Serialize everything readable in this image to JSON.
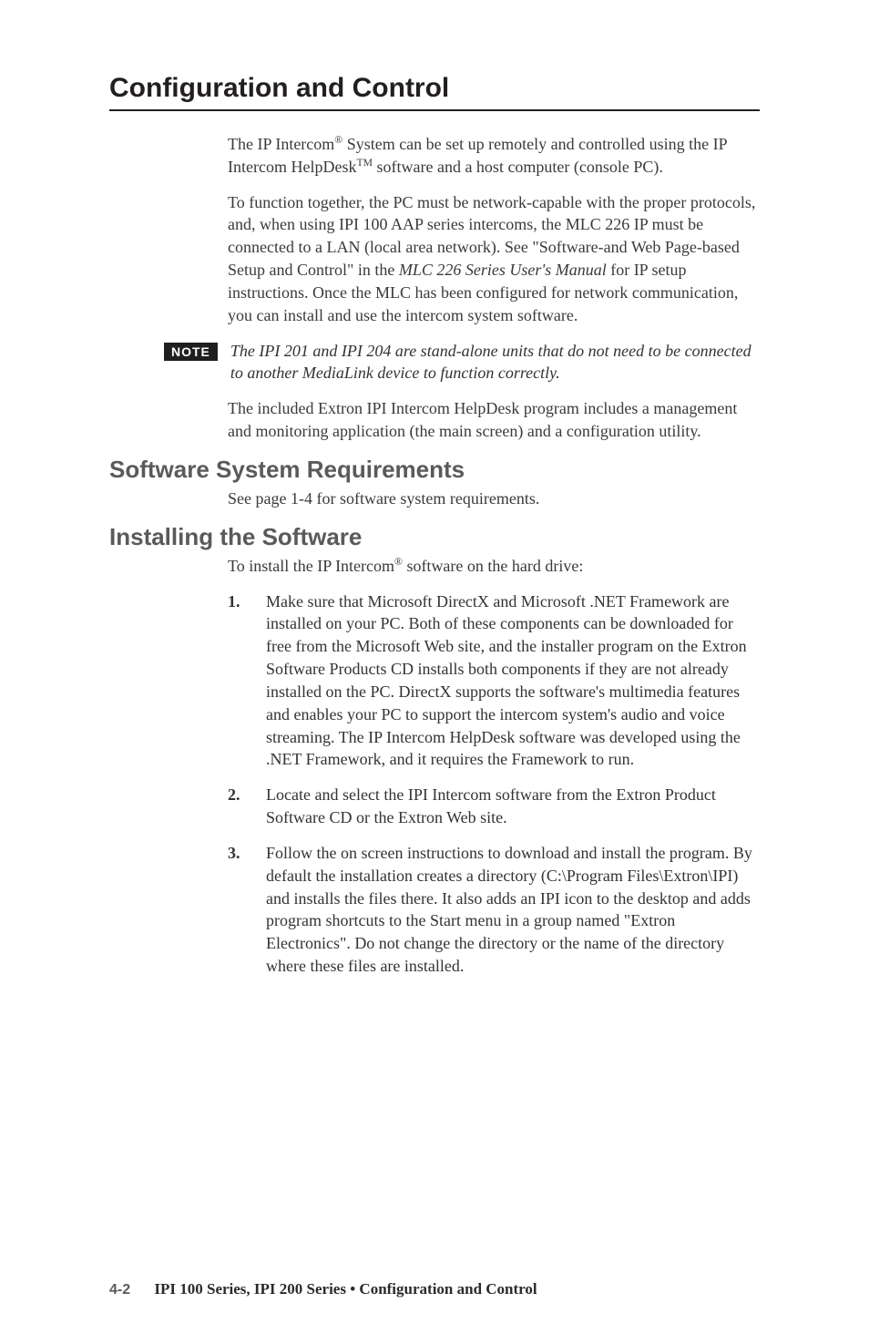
{
  "title": "Configuration and Control",
  "intro": {
    "p1_a": "The IP Intercom",
    "p1_b": " System can be set up remotely and controlled using the IP Intercom HelpDesk",
    "p1_c": " software and a host computer (console PC).",
    "p2_a": "To function together, the PC must be network-capable with the proper protocols, and, when using IPI 100 AAP series intercoms, the MLC 226 IP must be connected to a LAN (local area network).  See \"Software-and Web Page-based Setup and Control\" in the ",
    "p2_italic": "MLC 226 Series User's Manual",
    "p2_b": " for IP setup instructions.  Once the MLC has been configured for network communication, you can install and use the intercom system software."
  },
  "note": {
    "badge": "NOTE",
    "text": "The IPI 201 and IPI 204 are stand-alone units that do not need to be connected to another MediaLink device to function correctly."
  },
  "p3": "The included Extron IPI Intercom HelpDesk program includes a management and monitoring application (the main screen) and a configuration utility.",
  "sys_req": {
    "heading": "Software System Requirements",
    "text": "See page 1-4 for software system requirements."
  },
  "install": {
    "heading": "Installing the Software",
    "intro_a": "To install the IP Intercom",
    "intro_b": " software on the hard drive:",
    "items": [
      {
        "num": "1",
        "text": "Make sure that Microsoft DirectX and Microsoft .NET Framework are installed on your PC.  Both of these components can be downloaded for free from the Microsoft Web site, and the installer program on the Extron Software Products CD installs both components if they are not already installed on the PC.  DirectX supports the software's multimedia features and enables your PC to support the intercom system's audio and voice streaming.  The IP Intercom HelpDesk software was developed using the .NET Framework, and it requires the Framework to run."
      },
      {
        "num": "2",
        "text": "Locate and select the IPI Intercom software from the Extron Product Software CD or the Extron Web site."
      },
      {
        "num": "3",
        "text": "Follow the on screen instructions to download and install the program.  By default the installation creates a directory (C:\\Program Files\\Extron\\IPI) and installs the files there.  It also adds an IPI icon to the desktop and adds program shortcuts to the Start menu in a group named \"Extron Electronics\".  Do not change the directory or the name of the directory where these files are installed."
      }
    ]
  },
  "footer": {
    "page": "4-2",
    "text": "IPI 100 Series, IPI 200 Series • Configuration and Control"
  }
}
